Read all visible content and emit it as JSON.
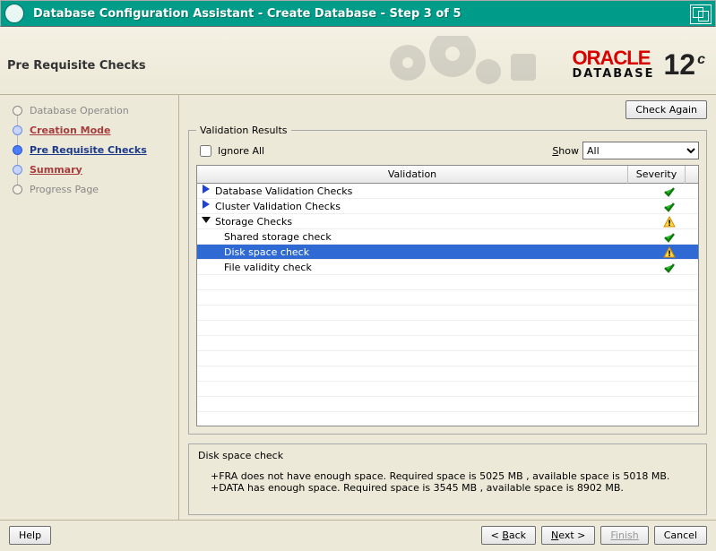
{
  "window": {
    "title": "Database Configuration Assistant - Create Database - Step 3 of 5"
  },
  "header": {
    "page_title": "Pre Requisite Checks",
    "brand_name": "ORACLE",
    "brand_sub": "DATABASE",
    "version_num": "12",
    "version_suffix": "c"
  },
  "sidebar": {
    "items": [
      {
        "label": "Database Operation",
        "state": "visited_plain"
      },
      {
        "label": "Creation Mode",
        "state": "visited"
      },
      {
        "label": "Pre Requisite Checks",
        "state": "active"
      },
      {
        "label": "Summary",
        "state": "visited"
      },
      {
        "label": "Progress Page",
        "state": "future"
      }
    ]
  },
  "content": {
    "check_again_label": "Check Again",
    "legend": "Validation Results",
    "ignore_all_label": "Ignore All",
    "show_label": "Show",
    "show_options": [
      "All"
    ],
    "show_selected": "All",
    "columns": {
      "validation": "Validation",
      "severity": "Severity"
    },
    "rows": [
      {
        "label": "Database Validation Checks",
        "level": 0,
        "expand": "right",
        "severity": "ok"
      },
      {
        "label": "Cluster Validation Checks",
        "level": 0,
        "expand": "right",
        "severity": "ok"
      },
      {
        "label": "Storage Checks",
        "level": 0,
        "expand": "down",
        "severity": "warn"
      },
      {
        "label": "Shared storage check",
        "level": 1,
        "expand": "",
        "severity": "ok"
      },
      {
        "label": "Disk space check",
        "level": 1,
        "expand": "",
        "severity": "warn",
        "selected": true
      },
      {
        "label": "File validity check",
        "level": 1,
        "expand": "",
        "severity": "ok"
      }
    ],
    "detail": {
      "title": "Disk space check",
      "lines": [
        "+FRA does not have enough space. Required space is 5025 MB , available space is 5018 MB.",
        "+DATA has enough space. Required space is 3545 MB , available space is 8902 MB."
      ]
    }
  },
  "buttons": {
    "help": "Help",
    "back": "< Back",
    "next": "Next >",
    "finish": "Finish",
    "cancel": "Cancel"
  }
}
